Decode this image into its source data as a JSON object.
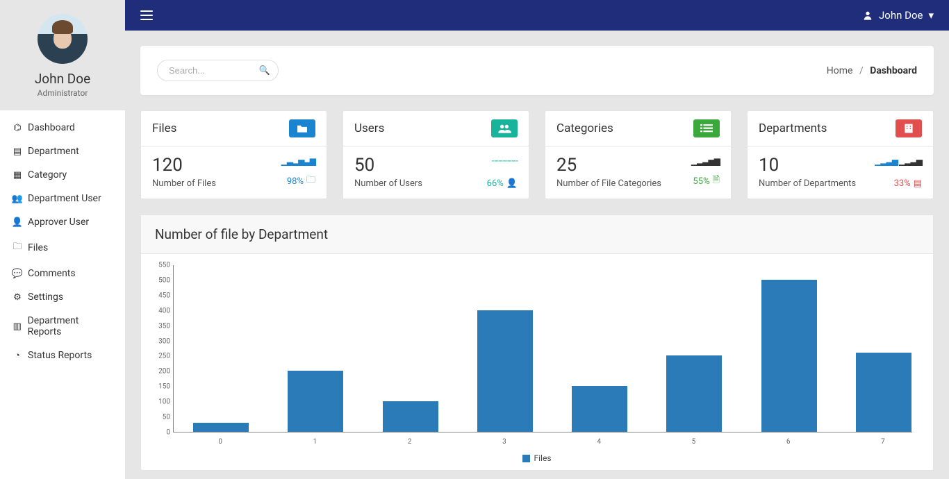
{
  "user": {
    "name": "John Doe",
    "role": "Administrator"
  },
  "topnav": {
    "username": "John Doe"
  },
  "search": {
    "placeholder": "Search..."
  },
  "breadcrumb": {
    "home": "Home",
    "current": "Dashboard"
  },
  "sidebar": {
    "items": [
      {
        "icon": "dashboard",
        "label": "Dashboard"
      },
      {
        "icon": "building",
        "label": "Department"
      },
      {
        "icon": "grid",
        "label": "Category"
      },
      {
        "icon": "users",
        "label": "Department User"
      },
      {
        "icon": "user",
        "label": "Approver User"
      },
      {
        "icon": "folder",
        "label": "Files"
      },
      {
        "icon": "comment",
        "label": "Comments"
      },
      {
        "icon": "gear",
        "label": "Settings"
      },
      {
        "icon": "barchart",
        "label": "Department Reports"
      },
      {
        "icon": "piechart",
        "label": "Status Reports"
      }
    ]
  },
  "stats": [
    {
      "title": "Files",
      "value": "120",
      "sub": "Number of Files",
      "pct": "98%",
      "color": "blue"
    },
    {
      "title": "Users",
      "value": "50",
      "sub": "Number of Users",
      "pct": "66%",
      "color": "teal"
    },
    {
      "title": "Categories",
      "value": "25",
      "sub": "Number of File Categories",
      "pct": "55%",
      "color": "green"
    },
    {
      "title": "Departments",
      "value": "10",
      "sub": "Number of Departments",
      "pct": "33%",
      "color": "red"
    }
  ],
  "chart": {
    "title": "Number of file by Department"
  },
  "chart_data": {
    "type": "bar",
    "categories": [
      "0",
      "1",
      "2",
      "3",
      "4",
      "5",
      "6",
      "7"
    ],
    "values": [
      30,
      200,
      100,
      400,
      150,
      250,
      500,
      260
    ],
    "legend": "Files",
    "ylim": [
      0,
      550
    ],
    "yticks": [
      0,
      50,
      100,
      150,
      200,
      250,
      300,
      350,
      400,
      450,
      500,
      550
    ]
  }
}
